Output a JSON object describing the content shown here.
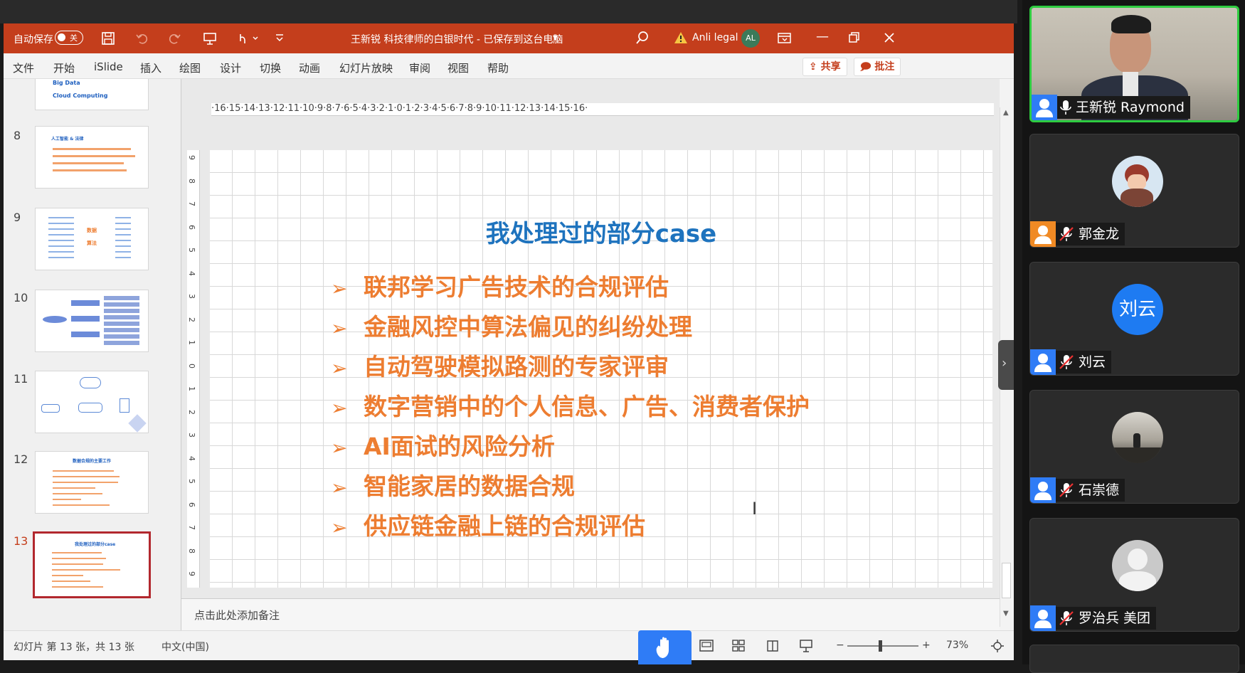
{
  "app": {
    "autosave_label": "自动保存",
    "autosave_state": "关",
    "doc_title": "王新锐  科技律师的白银时代 - 已保存到这台电脑",
    "account_name": "Anli legal",
    "account_initials": "AL"
  },
  "menu": {
    "items": [
      "文件",
      "开始",
      "iSlide",
      "插入",
      "绘图",
      "设计",
      "切换",
      "动画",
      "幻灯片放映",
      "审阅",
      "视图",
      "帮助"
    ],
    "share_label": "共享",
    "comment_label": "批注"
  },
  "thumbnails": {
    "first_partial": {
      "line1": "Big Data",
      "line2": "Cloud Computing"
    },
    "slides": [
      {
        "number": "8",
        "title": "人工智能 & 法律"
      },
      {
        "number": "9",
        "center_left": "数据",
        "center_right": "算法"
      },
      {
        "number": "10"
      },
      {
        "number": "11"
      },
      {
        "number": "12",
        "title": "数据合规的主要工作"
      },
      {
        "number": "13",
        "title": "我处理过的部分case",
        "selected": true
      }
    ]
  },
  "ruler": {
    "horizontal": "·16·15·14·13·12·11·10·9·8·7·6·5·4·3·2·1·0·1·2·3·4·5·6·7·8·9·10·11·12·13·14·15·16·",
    "vertical": [
      "9",
      "8",
      "7",
      "6",
      "5",
      "4",
      "3",
      "2",
      "1",
      "0",
      "1",
      "2",
      "3",
      "4",
      "5",
      "6",
      "7",
      "8",
      "9"
    ]
  },
  "slide": {
    "title": "我处理过的部分case",
    "bullet_glyph": "➢",
    "bullets": [
      "联邦学习广告技术的合规评估",
      "金融风控中算法偏见的纠纷处理",
      "自动驾驶模拟路测的专家评审",
      "数字营销中的个人信息、广告、消费者保护",
      "AI面试的风险分析",
      "智能家居的数据合规",
      "供应链金融上链的合规评估"
    ]
  },
  "notes": {
    "placeholder": "点击此处添加备注"
  },
  "status": {
    "slide_counter": "幻灯片 第 13 张，共 13 张",
    "language": "中文(中国)",
    "zoom": "73%"
  },
  "participants": [
    {
      "name": "王新锐 Raymond",
      "mic": "on",
      "active": true
    },
    {
      "name": "郭金龙",
      "mic": "muted",
      "icon_color": "#f08a24"
    },
    {
      "name": "刘云",
      "mic": "muted",
      "avatar_text": "刘云",
      "avatar_color": "#1e7bf2"
    },
    {
      "name": "石崇德",
      "mic": "muted"
    },
    {
      "name": "罗治兵  美团",
      "mic": "muted"
    }
  ],
  "colors": {
    "ppt_accent": "#c43e1c",
    "slide_title": "#1e73be",
    "slide_bullets": "#ed7d31",
    "active_speaker": "#2ecc40",
    "meeting_blue": "#2f7cf6"
  }
}
